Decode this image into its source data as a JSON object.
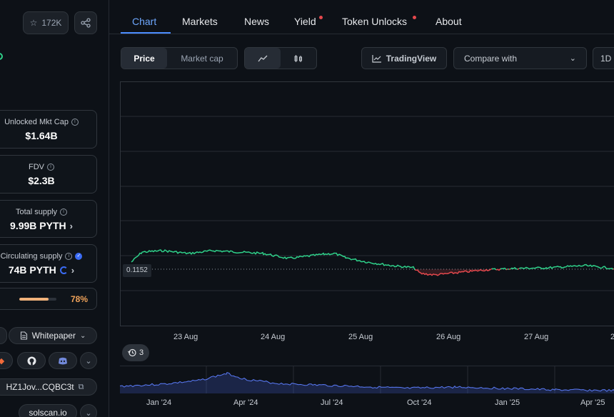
{
  "left": {
    "star_count": "172K",
    "stats": [
      {
        "label": "Unlocked Mkt Cap",
        "value": "$1.64B"
      },
      {
        "label": "FDV",
        "value": "$2.3B"
      },
      {
        "label": "Total supply",
        "value": "9.99B PYTH"
      },
      {
        "label": "Circulating supply",
        "value": "74B PYTH"
      }
    ],
    "progress_pct": "78%",
    "progress_value": 0.78,
    "whitepaper_label": "Whitepaper",
    "contract_address": "HZ1Jov...CQBC3t",
    "explorer": "solscan.io"
  },
  "tabs": [
    {
      "label": "Chart",
      "active": true
    },
    {
      "label": "Markets"
    },
    {
      "label": "News"
    },
    {
      "label": "Yield",
      "dot": true
    },
    {
      "label": "Token Unlocks",
      "dot": true
    },
    {
      "label": "About"
    }
  ],
  "toolbar": {
    "price_label": "Price",
    "mktcap_label": "Market cap",
    "tradingview_label": "TradingView",
    "compare_label": "Compare with",
    "range_label": "1D"
  },
  "chart": {
    "current_price": "0.1152",
    "x_labels": [
      "23 Aug",
      "24 Aug",
      "25 Aug",
      "26 Aug",
      "27 Aug"
    ],
    "history_count": "3",
    "mini_labels": [
      "Jan '24",
      "Apr '24",
      "Jul '24",
      "Oct '24",
      "Jan '25",
      "Apr '25"
    ]
  },
  "chart_data": {
    "type": "line",
    "baseline": 0.1152,
    "x": [
      "23 Aug",
      "24 Aug",
      "25 Aug",
      "26 Aug",
      "27 Aug"
    ],
    "colors": {
      "above": "#2fd18a",
      "below": "#e5484d"
    }
  }
}
